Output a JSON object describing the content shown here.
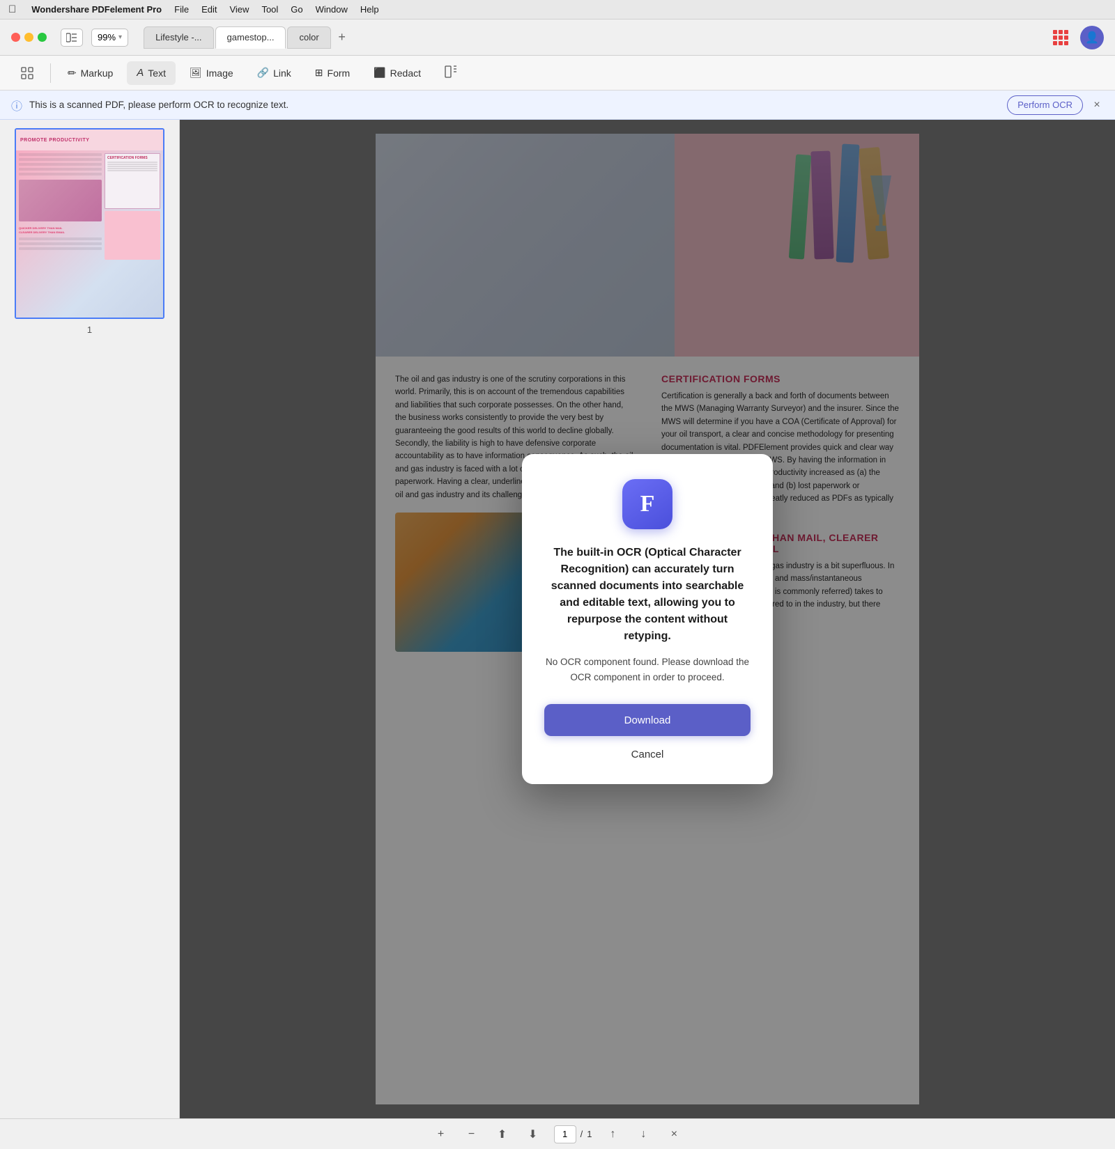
{
  "menubar": {
    "apple": "⌘",
    "app_name": "Wondershare PDFelement Pro",
    "items": [
      "File",
      "Edit",
      "View",
      "Tool",
      "Go",
      "Window",
      "Help"
    ]
  },
  "titlebar": {
    "zoom_level": "99%",
    "tabs": [
      {
        "label": "Lifestyle -...",
        "active": false
      },
      {
        "label": "gamestop...",
        "active": true
      },
      {
        "label": "color",
        "active": false
      }
    ],
    "add_tab_label": "+",
    "grid_btn_label": "⊞"
  },
  "toolbar": {
    "buttons": [
      {
        "label": "Markup",
        "icon": "✏️"
      },
      {
        "label": "Text",
        "icon": "A"
      },
      {
        "label": "Image",
        "icon": "🖼"
      },
      {
        "label": "Link",
        "icon": "🔗"
      },
      {
        "label": "Form",
        "icon": "⊞"
      },
      {
        "label": "Redact",
        "icon": "⬛"
      },
      {
        "label": "⊡",
        "icon": "⊡"
      }
    ]
  },
  "ocr_banner": {
    "message": "This is a scanned PDF, please perform OCR to recognize text.",
    "button_label": "Perform OCR",
    "close_label": "×"
  },
  "sidebar": {
    "page_number": "1"
  },
  "bottom_bar": {
    "zoom_in": "+",
    "zoom_out": "−",
    "fit_top": "⬆",
    "fit_bottom": "⬇",
    "current_page": "1",
    "separator": "/",
    "total_pages": "1",
    "page_up": "↑",
    "page_down": "↓",
    "close": "×"
  },
  "modal": {
    "icon_letter": "F",
    "title": "The built-in OCR (Optical Character Recognition) can accurately turn scanned documents into searchable and editable text, allowing you to repurpose the content without retyping.",
    "description": "No OCR component found. Please download the OCR component in order to proceed.",
    "download_label": "Download",
    "cancel_label": "Cancel"
  },
  "pdf_content": {
    "left_text": "The oil and gas industry is one of the scrutiny corporations in this world. Primarily, this is on account of the tremendous capabilities and liabilities that such corporate possesses. On the other hand, the business works consistently to provide the very best by guaranteeing the good results of this world to decline globally. Secondly, the liability is high to have defensive corporate accountability as to have information consequence. As such, the oil and gas industry is faced with a lot of documentation and paperwork. Having a clear, underline the risks of operating in the oil and gas industry and its challenges, the gas industry.",
    "right_heading_1": "CERTIFICATION FORMS",
    "right_text_1": "Certification is generally a back and forth of documents between the MWS (Managing Warranty Surveyor) and the insurer. Since the MWS will determine if you have a COA (Certificate of Approval) for your oil transport, a clear and concise methodology for presenting documentation is vital. PDFElement provides quick and clear way to present information in the MWS. By having the information in every understandable layout, productivity increased as (a) the need to re-do tasks minimized and (b) lost paperwork or misunderstood paperwork is greatly reduced as PDFs as typically delivered digitally.",
    "right_heading_2": "QUICKER DELIVERY THAN MAIL, CLEARER DELIVERY THAN EMAIL",
    "right_text_2": "Sending mail in the oil and the gas industry is a bit superfluous. In a modern world of digital media and mass/instantaneous communication, snail mail (as it is commonly referred) takes to long. Emails are generally referred to in the industry, but there were emails without"
  }
}
